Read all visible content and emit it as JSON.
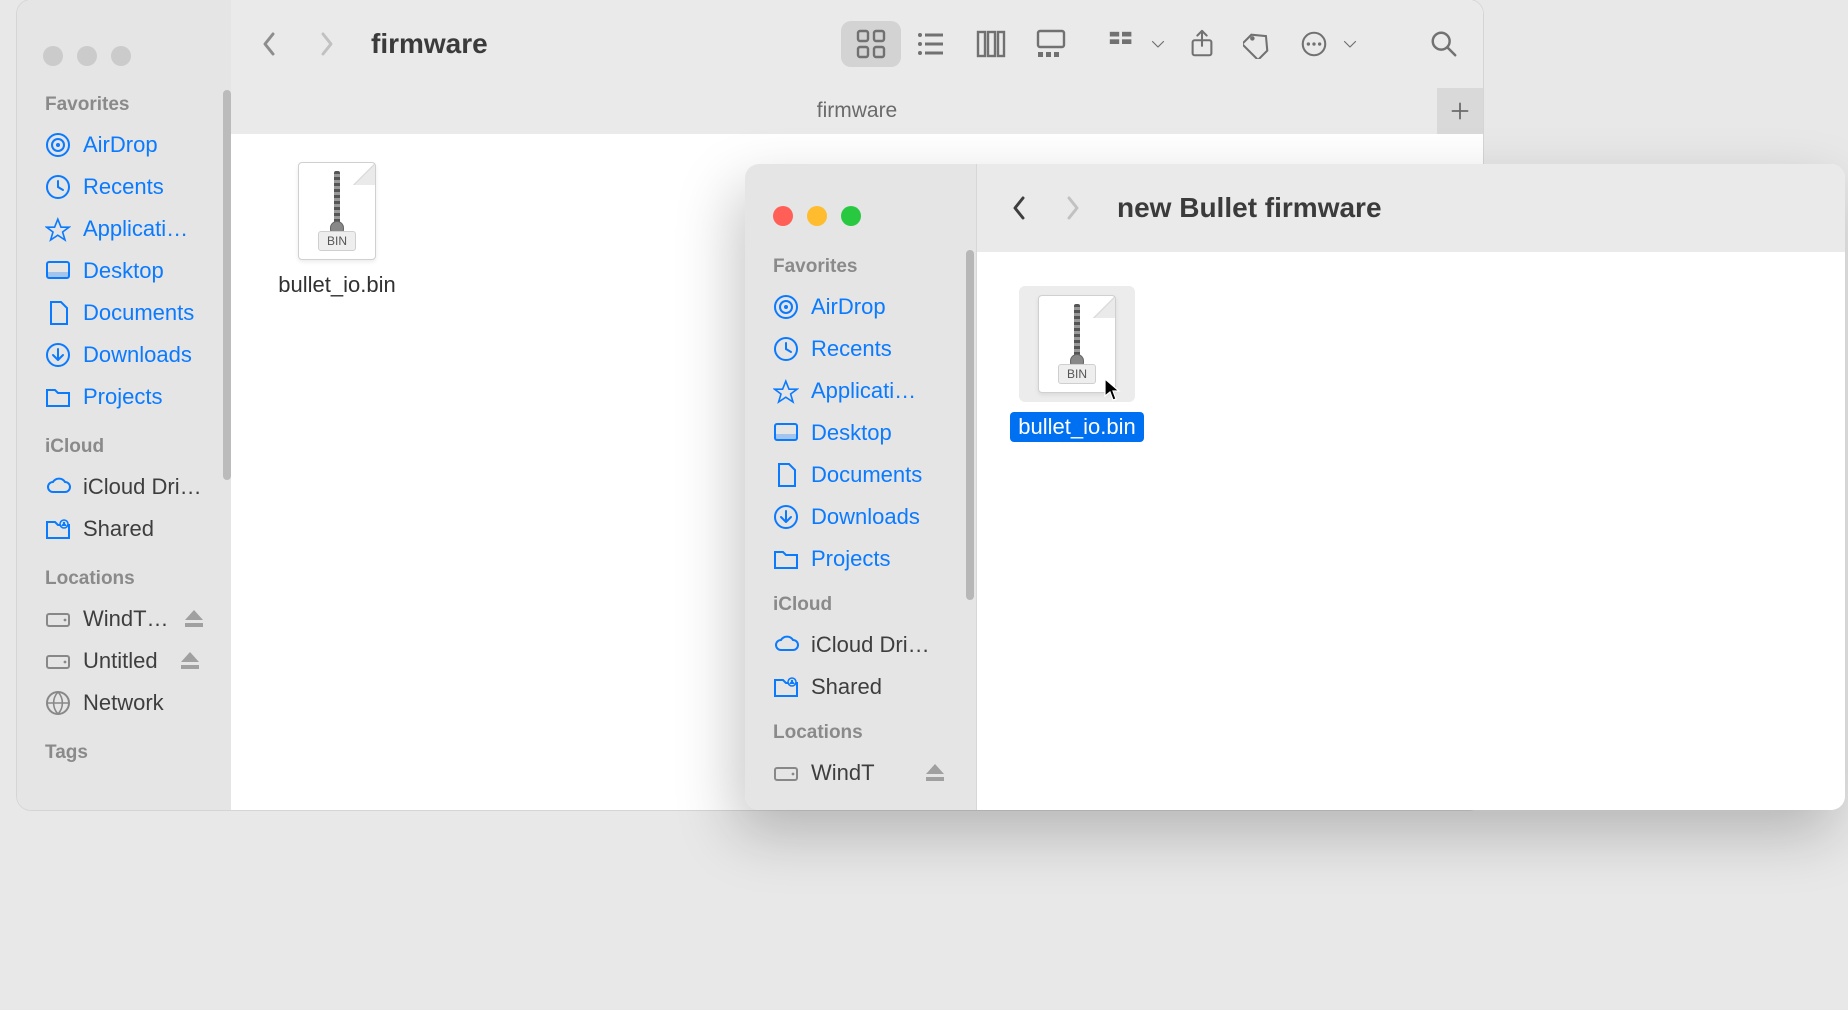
{
  "window1": {
    "title": "firmware",
    "pathbar": "firmware",
    "sidebar": {
      "sections": [
        {
          "heading": "Favorites",
          "items": [
            {
              "label": "AirDrop",
              "icon": "airdrop"
            },
            {
              "label": "Recents",
              "icon": "clock"
            },
            {
              "label": "Applicati…",
              "icon": "apps"
            },
            {
              "label": "Desktop",
              "icon": "desktop"
            },
            {
              "label": "Documents",
              "icon": "doc"
            },
            {
              "label": "Downloads",
              "icon": "download"
            },
            {
              "label": "Projects",
              "icon": "folder"
            }
          ]
        },
        {
          "heading": "iCloud",
          "items": [
            {
              "label": "iCloud Dri…",
              "icon": "cloud"
            },
            {
              "label": "Shared",
              "icon": "shared"
            }
          ]
        },
        {
          "heading": "Locations",
          "items": [
            {
              "label": "WindT…",
              "icon": "disk",
              "eject": true
            },
            {
              "label": "Untitled",
              "icon": "disk",
              "eject": true
            },
            {
              "label": "Network",
              "icon": "network"
            }
          ]
        },
        {
          "heading": "Tags",
          "items": []
        }
      ]
    },
    "files": [
      {
        "name": "bullet_io.bin",
        "badge": "BIN",
        "selected": false
      }
    ]
  },
  "window2": {
    "title": "new Bullet firmware",
    "sidebar": {
      "sections": [
        {
          "heading": "Favorites",
          "items": [
            {
              "label": "AirDrop",
              "icon": "airdrop"
            },
            {
              "label": "Recents",
              "icon": "clock"
            },
            {
              "label": "Applicati…",
              "icon": "apps"
            },
            {
              "label": "Desktop",
              "icon": "desktop"
            },
            {
              "label": "Documents",
              "icon": "doc"
            },
            {
              "label": "Downloads",
              "icon": "download"
            },
            {
              "label": "Projects",
              "icon": "folder"
            }
          ]
        },
        {
          "heading": "iCloud",
          "items": [
            {
              "label": "iCloud Dri…",
              "icon": "cloud"
            },
            {
              "label": "Shared",
              "icon": "shared"
            }
          ]
        },
        {
          "heading": "Locations",
          "items": [
            {
              "label": "WindT",
              "icon": "disk",
              "eject": true
            }
          ]
        }
      ]
    },
    "files": [
      {
        "name": "bullet_io.bin",
        "badge": "BIN",
        "selected": true
      }
    ]
  }
}
